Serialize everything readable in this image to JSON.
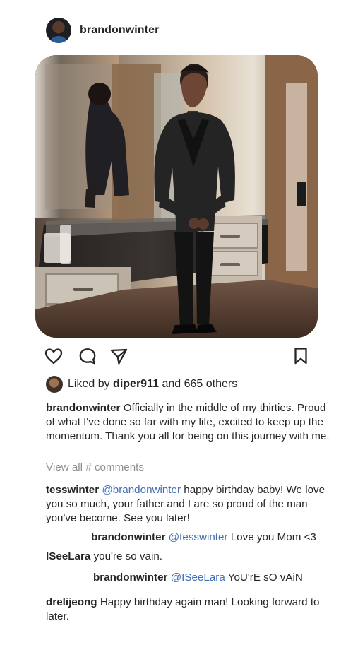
{
  "post": {
    "author": "brandonwinter",
    "likes": {
      "prefix": "Liked by",
      "user": "diper911",
      "suffix": "and 665 others"
    },
    "caption": {
      "author": "brandonwinter",
      "text": "Officially in the middle of my thirties. Proud of what I've done so far with my life, excited to keep up the momentum. Thank you all for being on this journey with me."
    },
    "view_all_comments": "View all # comments"
  },
  "comments": [
    {
      "author": "tesswinter",
      "mention": "@brandonwinter",
      "text": "happy birthday baby! We love you so much, your father and I are so proud of the man you've become. See you later!"
    },
    {
      "author": "brandonwinter",
      "mention": "@tesswinter",
      "text": "Love you Mom <3"
    },
    {
      "author": "ISeeLara",
      "mention": "",
      "text": "you're so vain."
    },
    {
      "author": "brandonwinter",
      "mention": "@ISeeLara",
      "text": "YoU'rE sO vAiN"
    },
    {
      "author": "drelijeong",
      "mention": "",
      "text": "Happy birthday again man! Looking forward to later."
    }
  ],
  "icons": {
    "like": "heart-outline-icon",
    "comment": "comment-bubble-icon",
    "share": "paper-plane-icon",
    "save": "bookmark-outline-icon"
  },
  "colors": {
    "text": "#262626",
    "muted": "#8e8e8e",
    "mention": "#3e6fb5",
    "background": "#ffffff"
  }
}
